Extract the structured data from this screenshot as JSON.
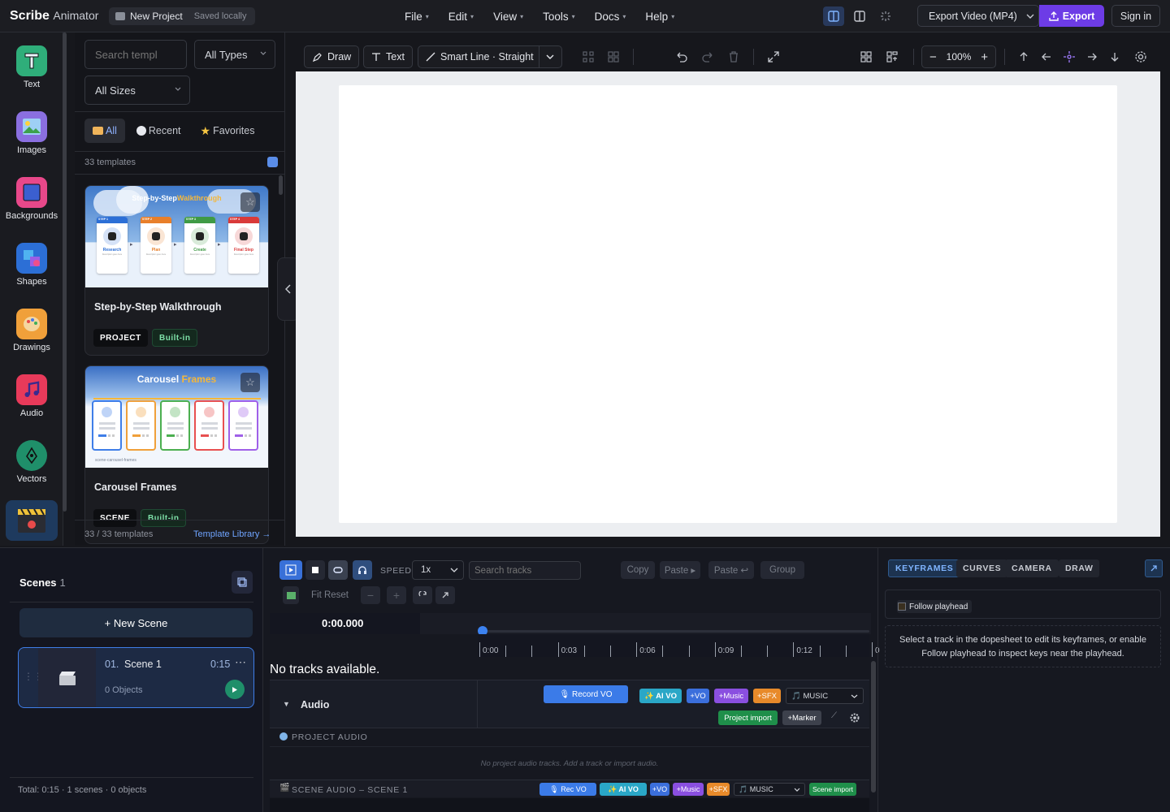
{
  "app": {
    "title": "Scribe",
    "subtitle": "Animator",
    "project_name": "New Project",
    "save_status": "Saved locally"
  },
  "menu": [
    {
      "label": "File"
    },
    {
      "label": "Edit"
    },
    {
      "label": "View"
    },
    {
      "label": "Tools"
    },
    {
      "label": "Docs"
    },
    {
      "label": "Help"
    }
  ],
  "header": {
    "export_format": "Export Video (MP4)",
    "export_label": "Export",
    "signin_label": "Sign in"
  },
  "rail": [
    {
      "label": "Text",
      "icon": "text-icon"
    },
    {
      "label": "Images",
      "icon": "images-icon"
    },
    {
      "label": "Backgrounds",
      "icon": "backgrounds-icon"
    },
    {
      "label": "Shapes",
      "icon": "shapes-icon"
    },
    {
      "label": "Drawings",
      "icon": "drawings-icon"
    },
    {
      "label": "Audio",
      "icon": "audio-icon"
    },
    {
      "label": "Vectors",
      "icon": "vectors-icon"
    }
  ],
  "templates": {
    "search_placeholder": "Search templ",
    "type_filter": "All Types",
    "size_filter": "All Sizes",
    "tabs": [
      {
        "label": "All"
      },
      {
        "label": "Recent"
      },
      {
        "label": "Favorites"
      }
    ],
    "count_label": "33 templates",
    "cards": [
      {
        "name": "Step-by-Step Walkthrough",
        "kind": "PROJECT",
        "origin": "Built-in",
        "thumb_title_a": "Step-by-Step",
        "thumb_title_b": "Walkthrough",
        "steps": [
          {
            "tag": "STEP 1",
            "label": "Research",
            "color": "#2c6fd6"
          },
          {
            "tag": "STEP 2",
            "label": "Plan",
            "color": "#e87f2a"
          },
          {
            "tag": "STEP 3",
            "label": "Create",
            "color": "#3f9a45"
          },
          {
            "tag": "STEP 4",
            "label": "Final Step",
            "color": "#d93a3a"
          }
        ],
        "step_desc": "Description goes here"
      },
      {
        "name": "Carousel Frames",
        "kind": "SCENE",
        "origin": "Built-in",
        "thumb_title_a": "Carousel",
        "thumb_title_b": "Frames",
        "thumb_caption": "scene-carousel-frames",
        "frame_colors": [
          "#3f7ee8",
          "#f0a03a",
          "#4caf50",
          "#e85050",
          "#a060e8"
        ]
      }
    ],
    "footer_count": "33 / 33 templates",
    "library_link": "Template Library →"
  },
  "toolbar": {
    "draw": "Draw",
    "text": "Text",
    "smart_line": "Smart Line · Straight",
    "zoom": "100%"
  },
  "scenes": {
    "title": "Scenes",
    "count": "1",
    "new_scene": "+ New Scene",
    "items": [
      {
        "index": "01.",
        "name": "Scene 1",
        "duration": "0:15",
        "objects": "0 Objects"
      }
    ],
    "total": "Total: 0:15 · 1 scenes · 0 objects"
  },
  "timeline": {
    "speed_label": "SPEED",
    "speed_value": "1x",
    "search_placeholder": "Search tracks",
    "copy": "Copy",
    "paste": "Paste ▸",
    "paste_b": "Paste ↩",
    "group": "Group",
    "fit_reset": "Fit Reset",
    "time": "0:00.000",
    "ticks": [
      "0:00",
      "0:03",
      "0:06",
      "0:09",
      "0:12",
      "0"
    ],
    "empty": "No tracks available.",
    "audio_label": "Audio",
    "record_vo": "🎙 Record VO",
    "ai_vo": "✨ AI VO",
    "vo": "+VO",
    "music": "+Music",
    "sfx": "+SFX",
    "music_select": "🎵 MUSIC",
    "project_import": "Project import",
    "marker": "+Marker",
    "project_audio": "PROJECT AUDIO",
    "project_audio_empty": "No project audio tracks. Add a track or import audio.",
    "scene_audio": "SCENE AUDIO – SCENE 1",
    "rec_vo": "🎙 Rec VO",
    "scene_import": "Scene import"
  },
  "inspector": {
    "tabs": [
      {
        "label": "KEYFRAMES"
      },
      {
        "label": "CURVES"
      },
      {
        "label": "CAMERA"
      },
      {
        "label": "DRAW"
      }
    ],
    "follow_label": "Follow playhead",
    "hint": "Select a track in the dopesheet to edit its keyframes, or enable Follow playhead to inspect keys near the playhead."
  }
}
